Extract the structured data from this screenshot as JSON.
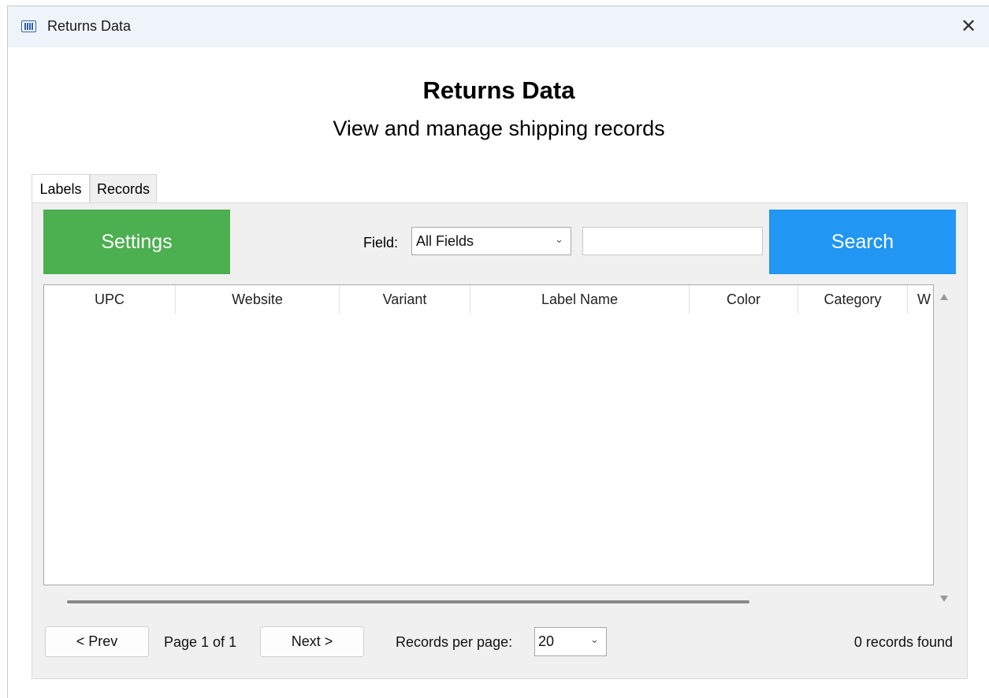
{
  "window": {
    "title": "Returns Data",
    "close_label": "✕"
  },
  "header": {
    "title": "Returns Data",
    "subtitle": "View and manage shipping records"
  },
  "tabs": [
    {
      "label": "Labels",
      "active": true
    },
    {
      "label": "Records",
      "active": false
    }
  ],
  "toolbar": {
    "settings_label": "Settings",
    "field_label": "Field:",
    "field_value": "All Fields",
    "search_value": "",
    "search_label": "Search"
  },
  "table": {
    "columns": [
      "UPC",
      "Website",
      "Variant",
      "Label Name",
      "Color",
      "Category",
      "W"
    ],
    "rows": []
  },
  "pagination": {
    "prev_label": "< Prev",
    "page_info": "Page 1 of 1",
    "next_label": "Next >",
    "rpp_label": "Records per page:",
    "rpp_value": "20",
    "records_found": "0 records found"
  },
  "colors": {
    "settings_button": "#4caf50",
    "search_button": "#2196f3"
  }
}
